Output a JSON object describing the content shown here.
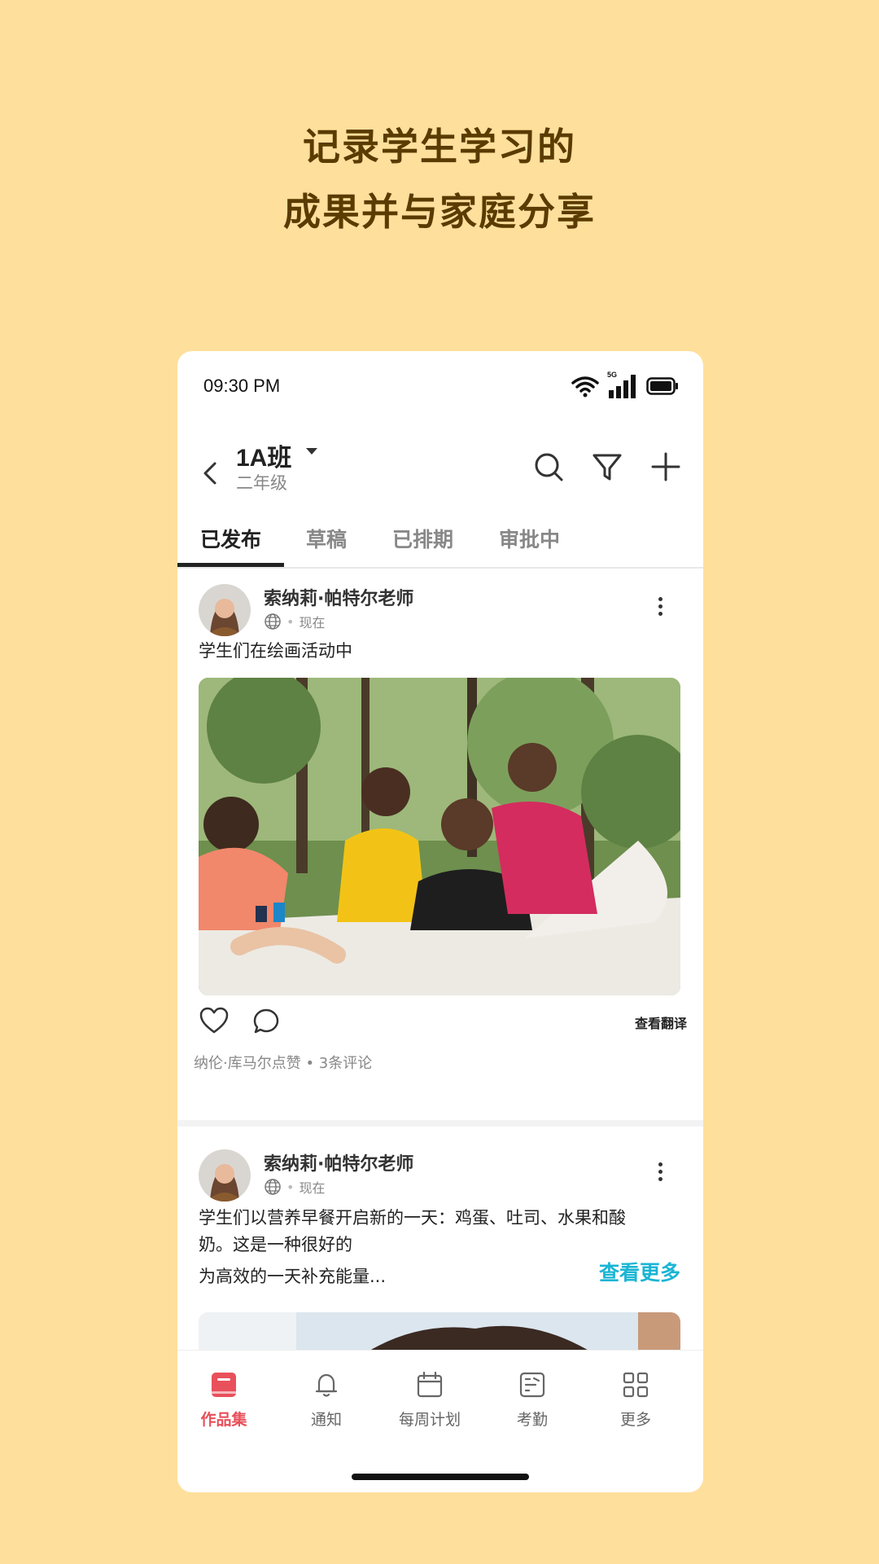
{
  "headline": {
    "line1": "记录学生学习的",
    "line2": "成果并与家庭分享"
  },
  "status_bar": {
    "time": "09:30 PM",
    "network": "5G"
  },
  "app_bar": {
    "class_name": "1A班",
    "grade": "二年级"
  },
  "tabs": [
    {
      "label": "已发布",
      "active": true
    },
    {
      "label": "草稿",
      "active": false
    },
    {
      "label": "已排期",
      "active": false
    },
    {
      "label": "审批中",
      "active": false
    }
  ],
  "posts": [
    {
      "author": "索纳莉·帕特尔老师",
      "time": "现在",
      "text": "学生们在绘画活动中",
      "translate_label": "查看翻译",
      "likes_comments": "纳伦·库马尔点赞 • 3条评论"
    },
    {
      "author": "索纳莉·帕特尔老师",
      "time": "现在",
      "text_line1": "学生们以营养早餐开启新的一天：鸡蛋、吐司、水果和酸",
      "text_line2": "奶。这是一种很好的",
      "text_line3": "为高效的一天补充能量...",
      "see_more": "查看更多"
    }
  ],
  "bottom_nav": [
    {
      "label": "作品集",
      "icon": "portfolio-icon",
      "active": true
    },
    {
      "label": "通知",
      "icon": "bell-icon",
      "active": false
    },
    {
      "label": "每周计划",
      "icon": "calendar-icon",
      "active": false
    },
    {
      "label": "考勤",
      "icon": "attendance-icon",
      "active": false
    },
    {
      "label": "更多",
      "icon": "grid-icon",
      "active": false
    }
  ],
  "colors": {
    "background": "#FFDF9C",
    "headline": "#5A3B00",
    "accent": "#E8505B",
    "link": "#1AB5D4"
  }
}
